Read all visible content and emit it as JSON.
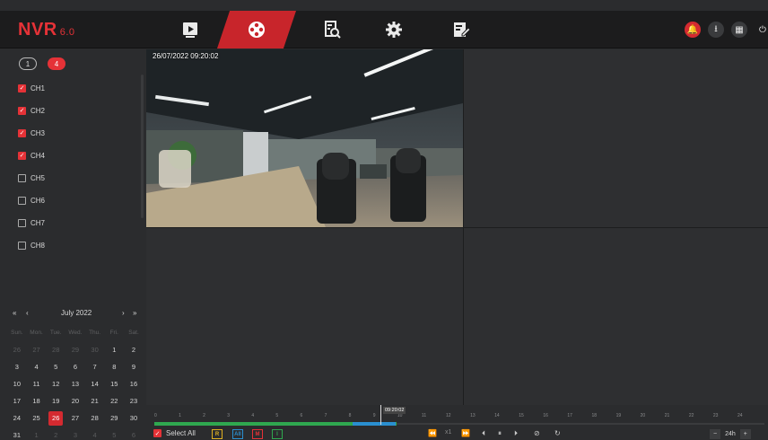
{
  "app": {
    "logo": "NVR",
    "version": "6.0"
  },
  "nav": {
    "tabs": [
      {
        "name": "playback-live",
        "icon": "play-icon"
      },
      {
        "name": "playback",
        "icon": "film-reel-icon",
        "active": true
      },
      {
        "name": "search",
        "icon": "search-doc-icon"
      },
      {
        "name": "settings",
        "icon": "gear-icon"
      },
      {
        "name": "edit",
        "icon": "edit-doc-icon"
      }
    ],
    "right_icons": [
      "alarm-icon",
      "download-icon",
      "grid-icon",
      "power-icon"
    ]
  },
  "split": {
    "one": "1",
    "four": "4"
  },
  "channels": [
    {
      "label": "CH1",
      "checked": true
    },
    {
      "label": "CH2",
      "checked": true
    },
    {
      "label": "CH3",
      "checked": true
    },
    {
      "label": "CH4",
      "checked": true
    },
    {
      "label": "CH5",
      "checked": false
    },
    {
      "label": "CH6",
      "checked": false
    },
    {
      "label": "CH7",
      "checked": false
    },
    {
      "label": "CH8",
      "checked": false
    }
  ],
  "calendar": {
    "prev_year": "«",
    "prev_month": "‹",
    "month_label": "July 2022",
    "next_month": "›",
    "next_year": "»",
    "weekdays": [
      "Sun.",
      "Mon.",
      "Tue.",
      "Wed.",
      "Thu.",
      "Fri.",
      "Sat."
    ],
    "weeks": [
      [
        "26",
        "27",
        "28",
        "29",
        "30",
        "1",
        "2"
      ],
      [
        "3",
        "4",
        "5",
        "6",
        "7",
        "8",
        "9"
      ],
      [
        "10",
        "11",
        "12",
        "13",
        "14",
        "15",
        "16"
      ],
      [
        "17",
        "18",
        "19",
        "20",
        "21",
        "22",
        "23"
      ],
      [
        "24",
        "25",
        "26",
        "27",
        "28",
        "29",
        "30"
      ],
      [
        "31",
        "1",
        "2",
        "3",
        "4",
        "5",
        "6"
      ]
    ],
    "selected": "26"
  },
  "video": {
    "osd": "26/07/2022 09:20:02"
  },
  "timeline": {
    "ticks": [
      "0",
      "1",
      "2",
      "3",
      "4",
      "5",
      "6",
      "7",
      "8",
      "9",
      "10",
      "11",
      "12",
      "13",
      "14",
      "15",
      "16",
      "17",
      "18",
      "19",
      "20",
      "21",
      "22",
      "23",
      "24"
    ],
    "cursor_time": "09:20:02"
  },
  "controls": {
    "select_all": "Select All",
    "filters": [
      "R",
      "All",
      "M",
      "I"
    ],
    "speed": "x1",
    "zoom_label": "24h",
    "zoom_minus": "−",
    "zoom_plus": "+"
  },
  "colors": {
    "accent": "#e53237",
    "record_green": "#2fa84f",
    "record_blue": "#2a8fd0"
  }
}
